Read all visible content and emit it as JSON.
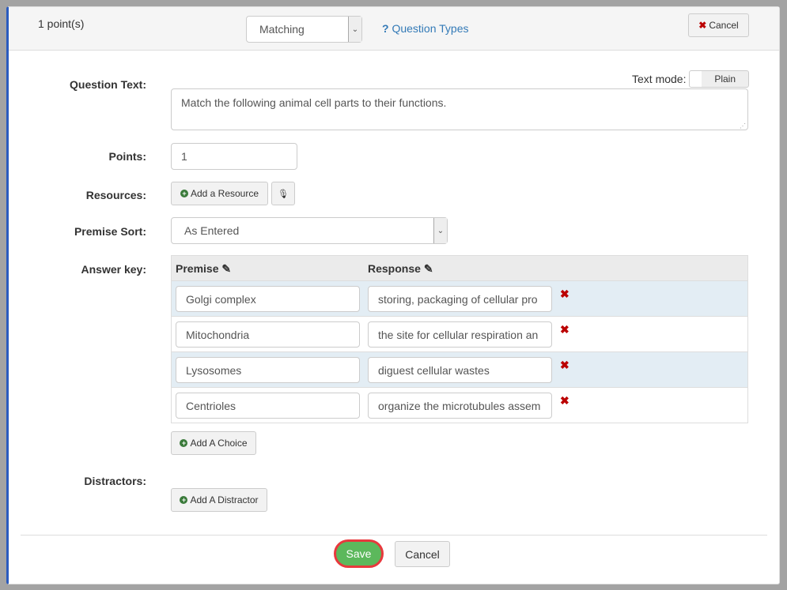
{
  "header": {
    "points": "1 point(s)",
    "type_select": "Matching",
    "help_link": "Question Types",
    "cancel": "Cancel"
  },
  "labels": {
    "question_text": "Question Text:",
    "points": "Points:",
    "resources": "Resources:",
    "premise_sort": "Premise Sort:",
    "answer_key": "Answer key:",
    "distractors": "Distractors:"
  },
  "text_mode": {
    "label": "Text mode:",
    "value": "Plain"
  },
  "question_text": "Match the following animal cell parts to their functions.",
  "points_value": "1",
  "add_resource": "Add a Resource",
  "premise_sort": "As Entered",
  "table": {
    "premise_header": "Premise",
    "response_header": "Response",
    "rows": [
      {
        "premise": "Golgi complex",
        "response": "storing, packaging of cellular pro"
      },
      {
        "premise": "Mitochondria",
        "response": "the site for cellular respiration an"
      },
      {
        "premise": "Lysosomes",
        "response": "diguest cellular wastes"
      },
      {
        "premise": "Centrioles",
        "response": "organize the microtubules assem"
      }
    ]
  },
  "add_choice": "Add A Choice",
  "add_distractor": "Add A Distractor",
  "footer": {
    "save": "Save",
    "cancel": "Cancel"
  },
  "colors": {
    "accent": "#2a5bbf",
    "save": "#5cb85c",
    "link": "#337ab7",
    "delete": "#b00000"
  }
}
